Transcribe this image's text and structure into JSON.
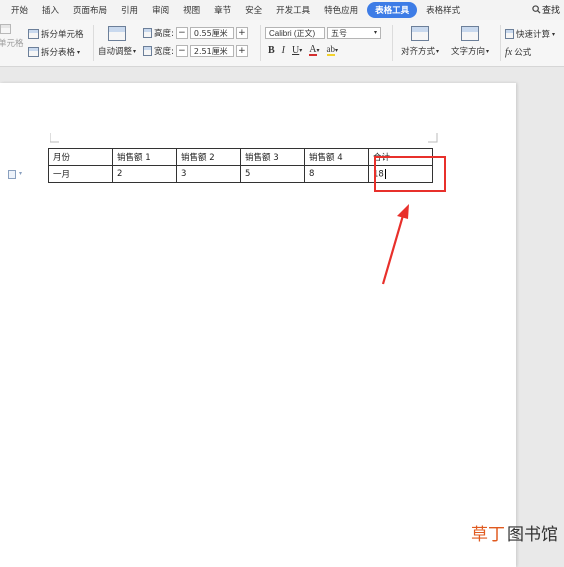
{
  "menu": {
    "items": [
      "开始",
      "插入",
      "页面布局",
      "引用",
      "审阅",
      "视图",
      "章节",
      "安全",
      "开发工具",
      "特色应用",
      "表格工具",
      "表格样式"
    ],
    "active_index": 10,
    "search_label": "查找"
  },
  "ribbon": {
    "merge_cells_label": "单元格",
    "split_cells_label": "拆分单元格",
    "split_table_label": "拆分表格",
    "auto_adjust_label": "自动调整",
    "height_label": "高度:",
    "height_value": "0.55厘米",
    "width_label": "宽度:",
    "width_value": "2.51厘米",
    "font_name": "Calibri (正文)",
    "font_size": "五号",
    "bold": "B",
    "italic": "I",
    "underline": "U",
    "font_color": "A",
    "highlight": "ab",
    "align_label": "对齐方式",
    "text_direction_label": "文字方向",
    "quick_calc_label": "快速计算",
    "formula_label": "公式",
    "formula_prefix": "fx",
    "minus": "−",
    "plus": "+"
  },
  "table": {
    "headers": [
      "月份",
      "销售额 1",
      "销售额 2",
      "销售额 3",
      "销售额 4",
      "合计"
    ],
    "rows": [
      [
        "一月",
        "2",
        "3",
        "5",
        "8",
        "18"
      ]
    ]
  },
  "watermark": {
    "part1": "草丁",
    "part2": "图书馆"
  },
  "colors": {
    "accent": "#3d7ce6",
    "highlight": "#e8302b",
    "watermark": "#e05a1f"
  }
}
